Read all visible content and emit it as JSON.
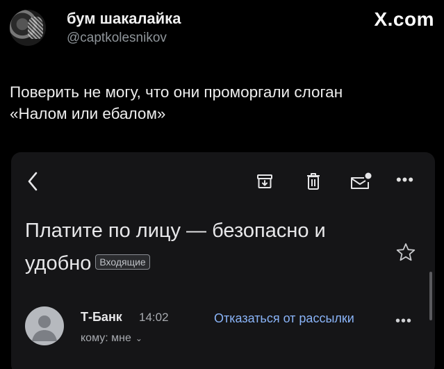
{
  "tweet": {
    "display_name": "бум шакалайка",
    "handle": "@captkolesnikov",
    "site_logo": "X.com",
    "text_line1": "Поверить не могу, что они проморгали слоган",
    "text_line2": "«Налом или ебалом»"
  },
  "email": {
    "toolbar": {
      "back_icon": "chevron-left-icon",
      "archive_icon": "archive-icon",
      "delete_icon": "trash-icon",
      "mark_unread_icon": "mail-dot-icon",
      "more_label": "•••"
    },
    "subject": "Платите по лицу — безопасно и удобно",
    "label": "Входящие",
    "sender": {
      "name": "Т-Банк",
      "time": "14:02",
      "recipient": "кому: мне",
      "unsubscribe": "Отказаться от рассылки",
      "more_label": "•••"
    }
  },
  "colors": {
    "background": "#000000",
    "card": "#151517",
    "link": "#8ab4f8"
  }
}
